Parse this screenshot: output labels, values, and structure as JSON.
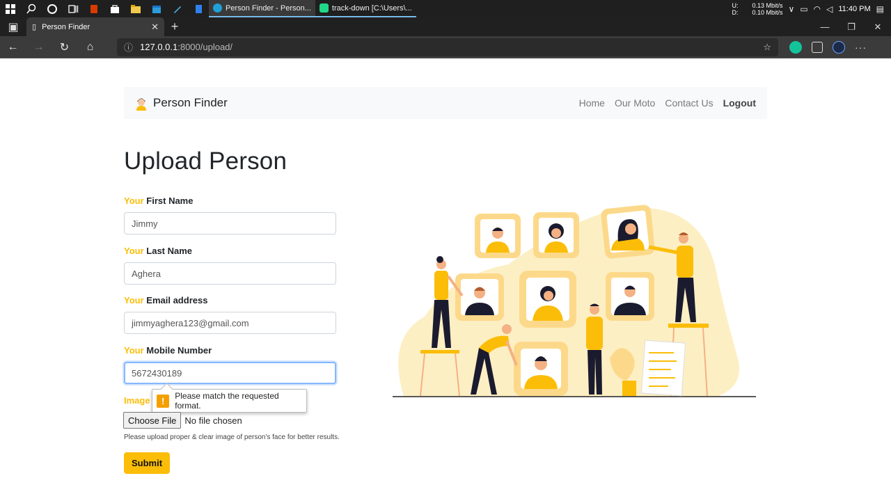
{
  "taskbar": {
    "apps": [
      {
        "label": "Person Finder - Person...",
        "icon": "edge-icon",
        "active": true
      },
      {
        "label": "track-down [C:\\Users\\...",
        "icon": "pycharm-icon",
        "active": false
      }
    ],
    "net_upload_label": "U:",
    "net_download_label": "D:",
    "net_upload": "0.13 Mbit/s",
    "net_download": "0.10 Mbit/s",
    "clock": "11:40 PM"
  },
  "browser": {
    "tab_title": "Person Finder",
    "url_host": "127.0.0.1",
    "url_rest": ":8000/upload/"
  },
  "navbar": {
    "brand": "Person Finder",
    "links": [
      "Home",
      "Our Moto",
      "Contact Us"
    ],
    "logout": "Logout"
  },
  "form": {
    "title": "Upload Person",
    "your": "Your",
    "first_name_label": "First Name",
    "first_name_value": "Jimmy",
    "last_name_label": "Last Name",
    "last_name_value": "Aghera",
    "email_label": "Email address",
    "email_value": "jimmyaghera123@gmail.com",
    "mobile_label": "Mobile Number",
    "mobile_value": "5672430189",
    "image_label": "Image",
    "choose_file": "Choose File",
    "no_file": "No file chosen",
    "help_text": "Please upload proper & clear image of person's face for better results.",
    "submit": "Submit",
    "validation_message": "Please match the requested format."
  },
  "colors": {
    "accent": "#fbbd08",
    "illustration_bg": "#fdefc4"
  }
}
